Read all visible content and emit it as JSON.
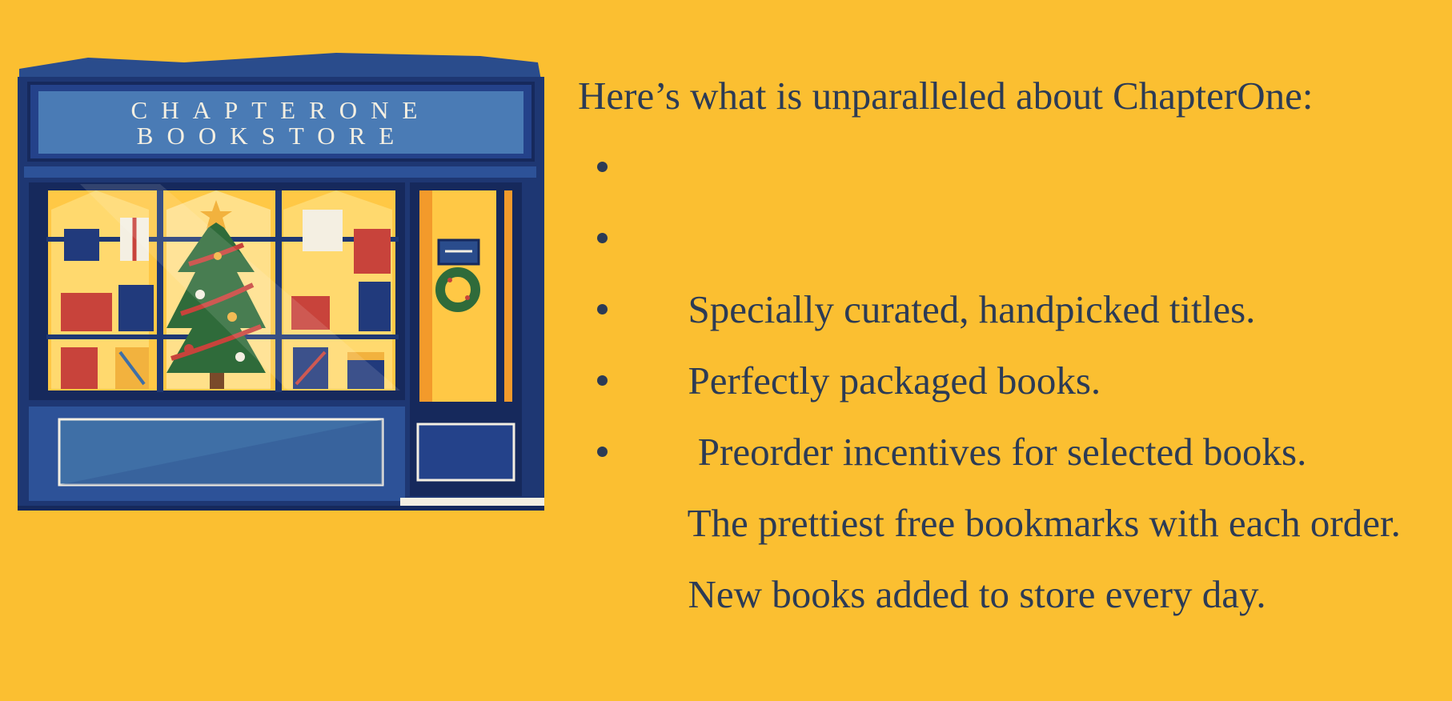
{
  "store": {
    "sign_line1": "CHAPTERONE",
    "sign_line2": "BOOKSTORE"
  },
  "heading": "Here’s what is unparalleled about ChapterOne:",
  "features": [
    "Specially curated, handpicked titles.",
    "Perfectly packaged books.",
    " Preorder incentives for selected books.",
    "The prettiest free bookmarks with each order.",
    "New books added to store every day."
  ],
  "colors": {
    "background": "#FBBF31",
    "text": "#2C3B55",
    "store_navy": "#213A7C",
    "store_blue": "#3F6FA6",
    "window_light": "#FFD25A",
    "tree_green": "#2F6B3A",
    "gift_red": "#C8433B"
  }
}
